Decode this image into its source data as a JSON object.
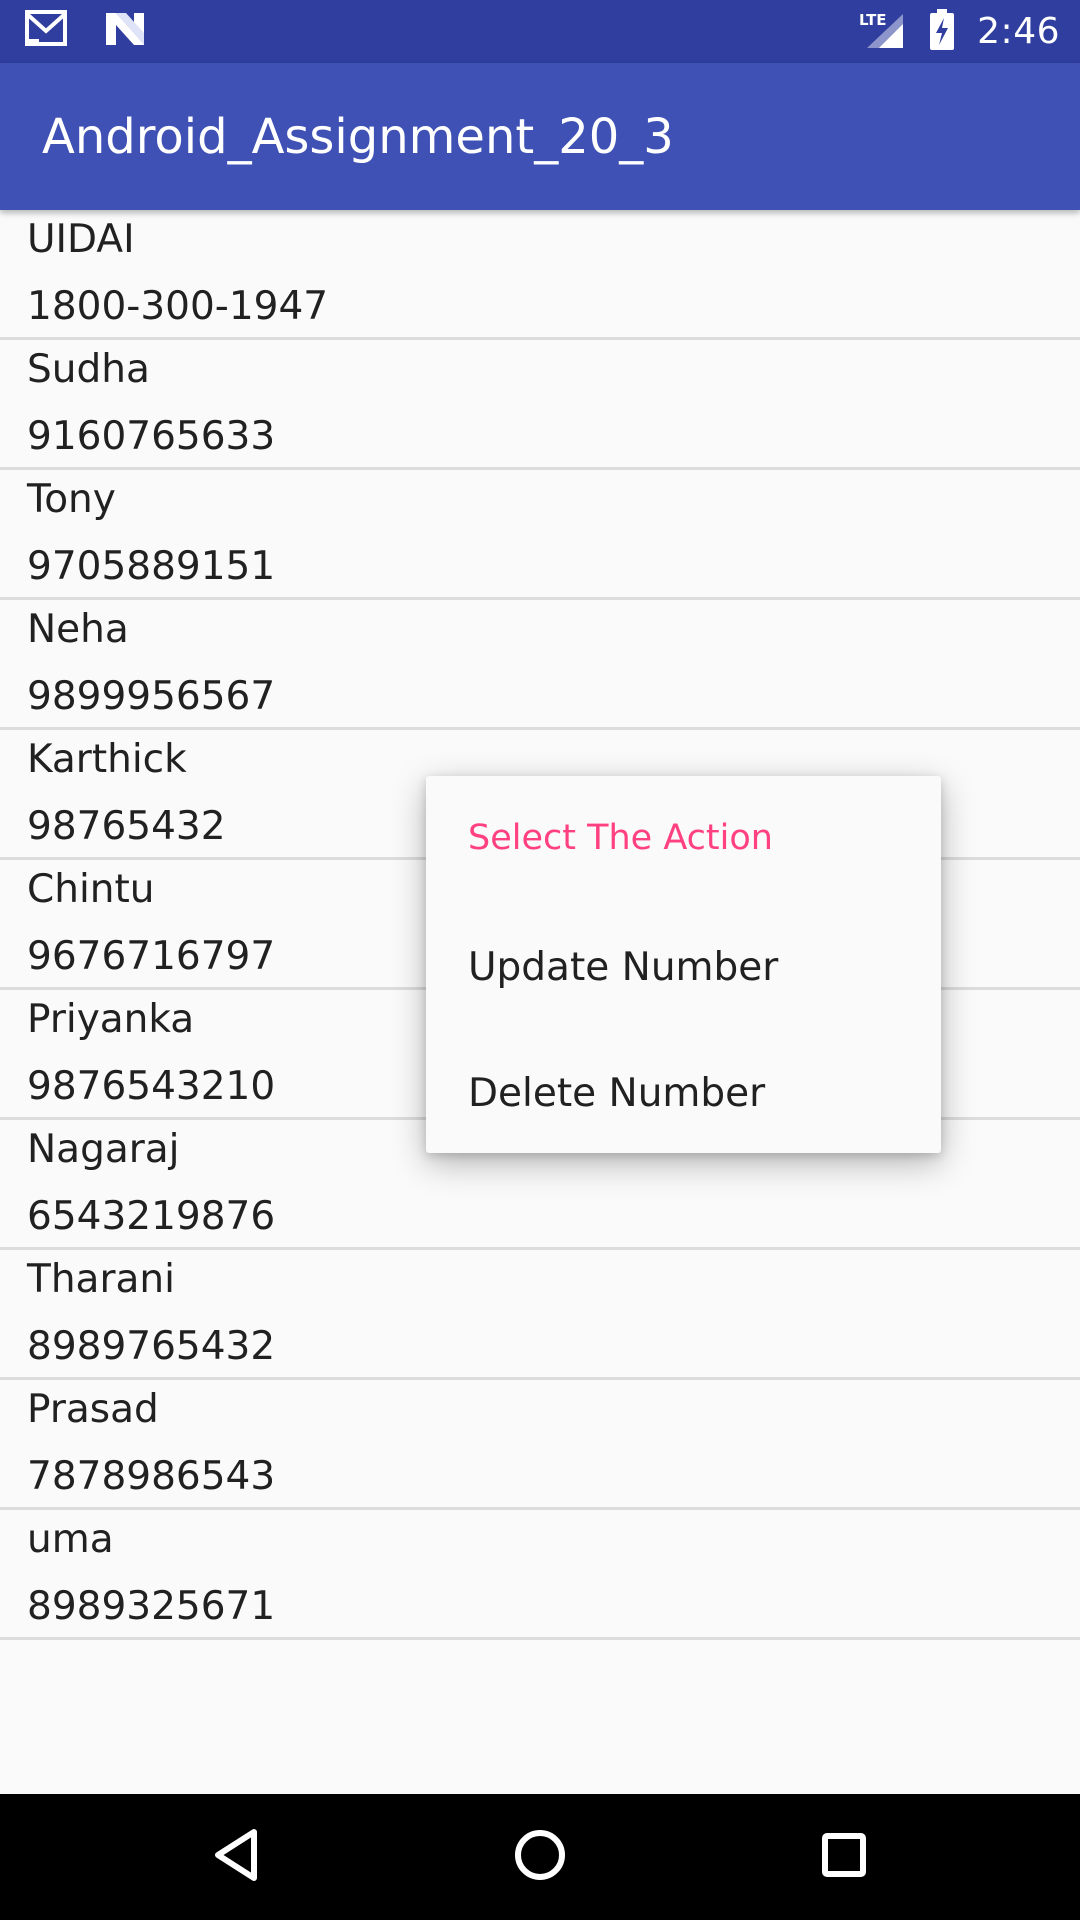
{
  "status_bar": {
    "time": "2:46",
    "network_label": "LTE",
    "icons": [
      "gmail-icon",
      "n-notification-icon",
      "signal-icon",
      "battery-charging-icon"
    ]
  },
  "app_bar": {
    "title": "Android_Assignment_20_3"
  },
  "contacts": [
    {
      "name": "UIDAI",
      "number": "1800-300-1947"
    },
    {
      "name": "Sudha",
      "number": "9160765633"
    },
    {
      "name": "Tony",
      "number": "9705889151"
    },
    {
      "name": "Neha",
      "number": "9899956567"
    },
    {
      "name": "Karthick",
      "number": "98765432"
    },
    {
      "name": "Chintu",
      "number": "9676716797"
    },
    {
      "name": "Priyanka",
      "number": "9876543210"
    },
    {
      "name": "Nagaraj",
      "number": "6543219876"
    },
    {
      "name": "Tharani",
      "number": "8989765432"
    },
    {
      "name": "Prasad",
      "number": "7878986543"
    },
    {
      "name": "uma",
      "number": "8989325671"
    }
  ],
  "context_menu": {
    "title": "Select The Action",
    "items": [
      "Update Number",
      "Delete Number"
    ]
  },
  "nav_bar": {
    "buttons": [
      "back-icon",
      "home-icon",
      "recents-icon"
    ]
  },
  "colors": {
    "status_bar": "#303f9f",
    "app_bar": "#3f51b5",
    "accent": "#ff4081",
    "background": "#fafafa"
  }
}
